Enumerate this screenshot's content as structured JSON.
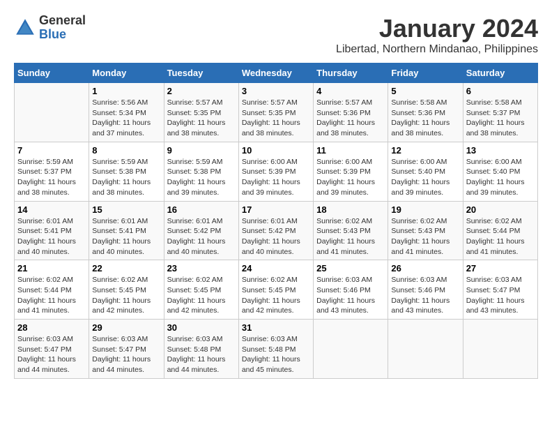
{
  "header": {
    "logo_general": "General",
    "logo_blue": "Blue",
    "title": "January 2024",
    "subtitle": "Libertad, Northern Mindanao, Philippines"
  },
  "days_of_week": [
    "Sunday",
    "Monday",
    "Tuesday",
    "Wednesday",
    "Thursday",
    "Friday",
    "Saturday"
  ],
  "weeks": [
    [
      {
        "day": "",
        "info": ""
      },
      {
        "day": "1",
        "info": "Sunrise: 5:56 AM\nSunset: 5:34 PM\nDaylight: 11 hours\nand 37 minutes."
      },
      {
        "day": "2",
        "info": "Sunrise: 5:57 AM\nSunset: 5:35 PM\nDaylight: 11 hours\nand 38 minutes."
      },
      {
        "day": "3",
        "info": "Sunrise: 5:57 AM\nSunset: 5:35 PM\nDaylight: 11 hours\nand 38 minutes."
      },
      {
        "day": "4",
        "info": "Sunrise: 5:57 AM\nSunset: 5:36 PM\nDaylight: 11 hours\nand 38 minutes."
      },
      {
        "day": "5",
        "info": "Sunrise: 5:58 AM\nSunset: 5:36 PM\nDaylight: 11 hours\nand 38 minutes."
      },
      {
        "day": "6",
        "info": "Sunrise: 5:58 AM\nSunset: 5:37 PM\nDaylight: 11 hours\nand 38 minutes."
      }
    ],
    [
      {
        "day": "7",
        "info": "Sunrise: 5:59 AM\nSunset: 5:37 PM\nDaylight: 11 hours\nand 38 minutes."
      },
      {
        "day": "8",
        "info": "Sunrise: 5:59 AM\nSunset: 5:38 PM\nDaylight: 11 hours\nand 38 minutes."
      },
      {
        "day": "9",
        "info": "Sunrise: 5:59 AM\nSunset: 5:38 PM\nDaylight: 11 hours\nand 39 minutes."
      },
      {
        "day": "10",
        "info": "Sunrise: 6:00 AM\nSunset: 5:39 PM\nDaylight: 11 hours\nand 39 minutes."
      },
      {
        "day": "11",
        "info": "Sunrise: 6:00 AM\nSunset: 5:39 PM\nDaylight: 11 hours\nand 39 minutes."
      },
      {
        "day": "12",
        "info": "Sunrise: 6:00 AM\nSunset: 5:40 PM\nDaylight: 11 hours\nand 39 minutes."
      },
      {
        "day": "13",
        "info": "Sunrise: 6:00 AM\nSunset: 5:40 PM\nDaylight: 11 hours\nand 39 minutes."
      }
    ],
    [
      {
        "day": "14",
        "info": "Sunrise: 6:01 AM\nSunset: 5:41 PM\nDaylight: 11 hours\nand 40 minutes."
      },
      {
        "day": "15",
        "info": "Sunrise: 6:01 AM\nSunset: 5:41 PM\nDaylight: 11 hours\nand 40 minutes."
      },
      {
        "day": "16",
        "info": "Sunrise: 6:01 AM\nSunset: 5:42 PM\nDaylight: 11 hours\nand 40 minutes."
      },
      {
        "day": "17",
        "info": "Sunrise: 6:01 AM\nSunset: 5:42 PM\nDaylight: 11 hours\nand 40 minutes."
      },
      {
        "day": "18",
        "info": "Sunrise: 6:02 AM\nSunset: 5:43 PM\nDaylight: 11 hours\nand 41 minutes."
      },
      {
        "day": "19",
        "info": "Sunrise: 6:02 AM\nSunset: 5:43 PM\nDaylight: 11 hours\nand 41 minutes."
      },
      {
        "day": "20",
        "info": "Sunrise: 6:02 AM\nSunset: 5:44 PM\nDaylight: 11 hours\nand 41 minutes."
      }
    ],
    [
      {
        "day": "21",
        "info": "Sunrise: 6:02 AM\nSunset: 5:44 PM\nDaylight: 11 hours\nand 41 minutes."
      },
      {
        "day": "22",
        "info": "Sunrise: 6:02 AM\nSunset: 5:45 PM\nDaylight: 11 hours\nand 42 minutes."
      },
      {
        "day": "23",
        "info": "Sunrise: 6:02 AM\nSunset: 5:45 PM\nDaylight: 11 hours\nand 42 minutes."
      },
      {
        "day": "24",
        "info": "Sunrise: 6:02 AM\nSunset: 5:45 PM\nDaylight: 11 hours\nand 42 minutes."
      },
      {
        "day": "25",
        "info": "Sunrise: 6:03 AM\nSunset: 5:46 PM\nDaylight: 11 hours\nand 43 minutes."
      },
      {
        "day": "26",
        "info": "Sunrise: 6:03 AM\nSunset: 5:46 PM\nDaylight: 11 hours\nand 43 minutes."
      },
      {
        "day": "27",
        "info": "Sunrise: 6:03 AM\nSunset: 5:47 PM\nDaylight: 11 hours\nand 43 minutes."
      }
    ],
    [
      {
        "day": "28",
        "info": "Sunrise: 6:03 AM\nSunset: 5:47 PM\nDaylight: 11 hours\nand 44 minutes."
      },
      {
        "day": "29",
        "info": "Sunrise: 6:03 AM\nSunset: 5:47 PM\nDaylight: 11 hours\nand 44 minutes."
      },
      {
        "day": "30",
        "info": "Sunrise: 6:03 AM\nSunset: 5:48 PM\nDaylight: 11 hours\nand 44 minutes."
      },
      {
        "day": "31",
        "info": "Sunrise: 6:03 AM\nSunset: 5:48 PM\nDaylight: 11 hours\nand 45 minutes."
      },
      {
        "day": "",
        "info": ""
      },
      {
        "day": "",
        "info": ""
      },
      {
        "day": "",
        "info": ""
      }
    ]
  ]
}
